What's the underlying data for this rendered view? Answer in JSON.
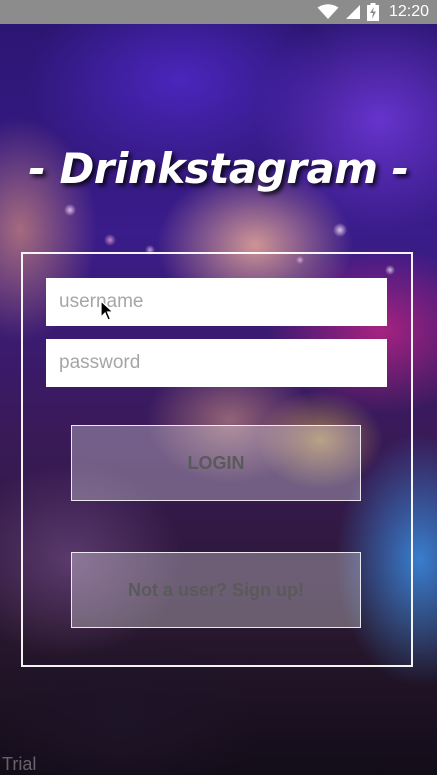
{
  "status_bar": {
    "time": "12:20",
    "icons": [
      "wifi-icon",
      "cell-signal-icon",
      "battery-charging-icon"
    ]
  },
  "app": {
    "title": "- Drinkstagram -"
  },
  "login_form": {
    "username_placeholder": "username",
    "username_value": "",
    "password_placeholder": "password",
    "password_value": "",
    "login_label": "LOGIN",
    "signup_label": "Not a user? Sign up!"
  },
  "watermark": {
    "text": "Trial"
  },
  "colors": {
    "status_bar_bg": "#8c8c8c",
    "field_bg": "#ffffff",
    "placeholder": "#a6a6a6",
    "button_text": "#5a5a5a",
    "frame_border": "#ffffff"
  }
}
